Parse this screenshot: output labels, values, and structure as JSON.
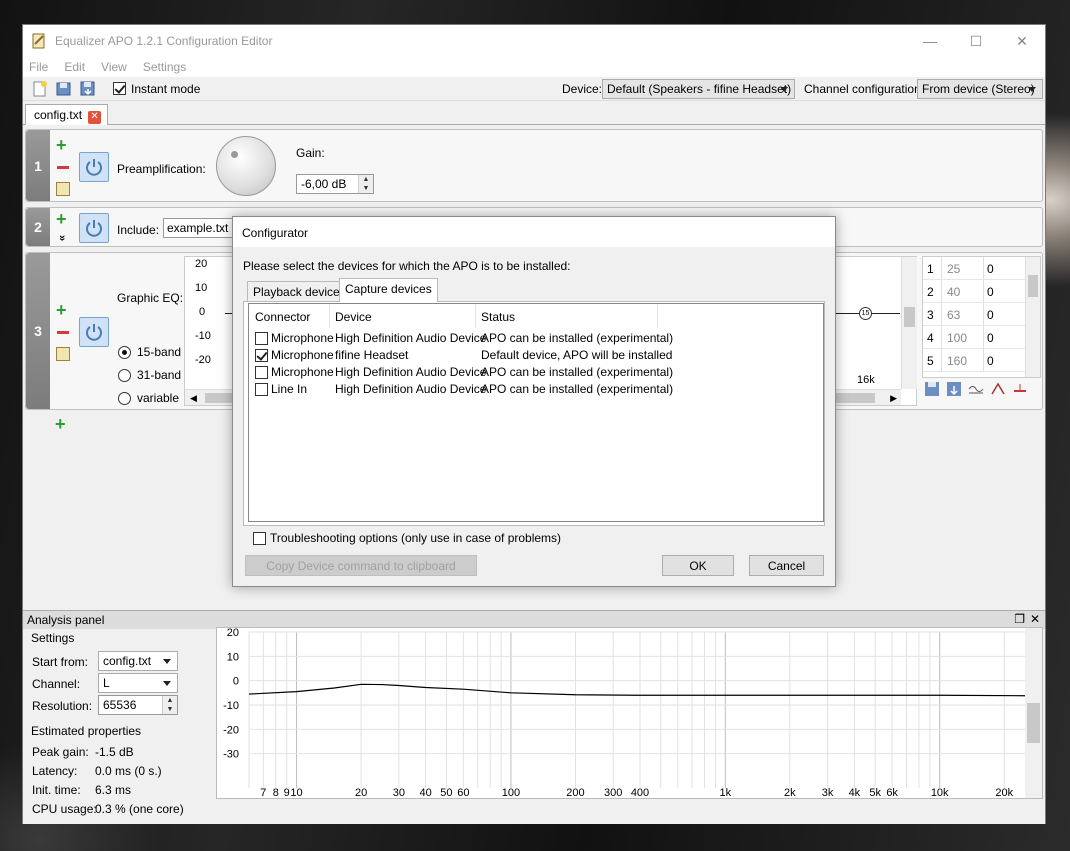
{
  "window": {
    "title": "Equalizer APO 1.2.1 Configuration Editor",
    "minimize": "—",
    "maximize": "☐",
    "close": "✕"
  },
  "menu": [
    "File",
    "Edit",
    "View",
    "Settings"
  ],
  "toolbar": {
    "instant_mode": "Instant mode",
    "instant_checked": true,
    "device_label": "Device:",
    "device_value": "Default (Speakers - fifine Headset)",
    "channel_label": "Channel configuration:",
    "channel_value": "From device (Stereo)"
  },
  "file_tab": {
    "name": "config.txt",
    "close": "✕"
  },
  "filters": [
    {
      "num": "1",
      "label": "Preamplification:",
      "gain_label": "Gain:",
      "gain_value": "-6,00 dB"
    },
    {
      "num": "2",
      "label": "Include:",
      "value": "example.txt",
      "expand": "»"
    },
    {
      "num": "3",
      "label": "Graphic EQ:",
      "radio_options": [
        "15-band",
        "31-band",
        "variable"
      ],
      "selected": "15-band",
      "y_ticks": [
        "20",
        "10",
        "0",
        "-10",
        "-20"
      ],
      "freq_label": "16k",
      "marker": "15"
    }
  ],
  "band_table": [
    [
      "1",
      "25",
      "0"
    ],
    [
      "2",
      "40",
      "0"
    ],
    [
      "3",
      "63",
      "0"
    ],
    [
      "4",
      "100",
      "0"
    ],
    [
      "5",
      "160",
      "0"
    ]
  ],
  "dialog": {
    "title": "Configurator",
    "instruction": "Please select the devices for which the APO is to be installed:",
    "tabs": [
      "Playback devices",
      "Capture devices"
    ],
    "active_tab": "Capture devices",
    "columns": [
      "Connector",
      "Device",
      "Status"
    ],
    "rows": [
      {
        "checked": false,
        "connector": "Microphone",
        "device": "High Definition Audio Device",
        "status": "APO can be installed (experimental)"
      },
      {
        "checked": true,
        "connector": "Microphone",
        "device": "fifine Headset",
        "status": "Default device, APO will be installed"
      },
      {
        "checked": false,
        "connector": "Microphone",
        "device": "High Definition Audio Device",
        "status": "APO can be installed (experimental)"
      },
      {
        "checked": false,
        "connector": "Line In",
        "device": "High Definition Audio Device",
        "status": "APO can be installed (experimental)"
      }
    ],
    "troubleshoot": "Troubleshooting options (only use in case of problems)",
    "copy_button": "Copy Device command to clipboard",
    "ok": "OK",
    "cancel": "Cancel"
  },
  "analysis": {
    "title": "Analysis panel",
    "settings_label": "Settings",
    "start_from_label": "Start from:",
    "start_from_value": "config.txt",
    "channel_label": "Channel:",
    "channel_value": "L",
    "resolution_label": "Resolution:",
    "resolution_value": "65536",
    "estimated_label": "Estimated properties",
    "peak_gain_label": "Peak gain:",
    "peak_gain_value": "-1.5 dB",
    "latency_label": "Latency:",
    "latency_value": "0.0 ms (0 s.)",
    "init_time_label": "Init. time:",
    "init_time_value": "6.3 ms",
    "cpu_label": "CPU usage:",
    "cpu_value": "0.3 % (one core)"
  },
  "chart_data": {
    "type": "line",
    "title": "",
    "xlabel": "",
    "ylabel": "",
    "x_scale": "log",
    "xlim": [
      6,
      25000
    ],
    "ylim": [
      -40,
      20
    ],
    "y_ticks": [
      20,
      10,
      0,
      -10,
      -20,
      -30
    ],
    "x_tick_labels": [
      "7",
      "8",
      "9",
      "10",
      "20",
      "30",
      "40",
      "50",
      "60",
      "100",
      "200",
      "300",
      "400",
      "1k",
      "2k",
      "3k",
      "4k",
      "5k",
      "6k",
      "10k",
      "20k"
    ],
    "x_tick_values": [
      7,
      8,
      9,
      10,
      20,
      30,
      40,
      50,
      60,
      100,
      200,
      300,
      400,
      1000,
      2000,
      3000,
      4000,
      5000,
      6000,
      10000,
      20000
    ],
    "grid": true,
    "series": [
      {
        "x": [
          6,
          10,
          15,
          20,
          25,
          30,
          40,
          60,
          100,
          200,
          400,
          1000,
          3000,
          10000,
          25000
        ],
        "y": [
          -5.5,
          -4.5,
          -3,
          -1.5,
          -1.6,
          -2,
          -2.8,
          -3.5,
          -5,
          -5.8,
          -6,
          -6,
          -6,
          -6,
          -6.2
        ]
      }
    ],
    "color": "#000000"
  }
}
